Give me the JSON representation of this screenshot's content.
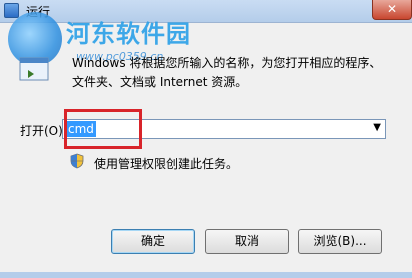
{
  "window": {
    "title": "运行",
    "close_symbol": "✕"
  },
  "watermark": {
    "title": "河东软件园",
    "url": "www.pc0359.cn"
  },
  "description": {
    "line1": "Windows 将根据您所输入的名称，为您打开相应的程序、",
    "line2": "文件夹、文档或 Internet 资源。"
  },
  "open": {
    "label": "打开(O):",
    "value": "cmd"
  },
  "admin_note": "使用管理权限创建此任务。",
  "buttons": {
    "ok": "确定",
    "cancel": "取消",
    "browse": "浏览(B)..."
  },
  "colors": {
    "highlight_border": "#d8242a",
    "selection": "#3399ff",
    "watermark": "#2aa0e8"
  },
  "icons": [
    "run-icon",
    "shield-icon",
    "dropdown-arrow-icon",
    "close-icon"
  ]
}
